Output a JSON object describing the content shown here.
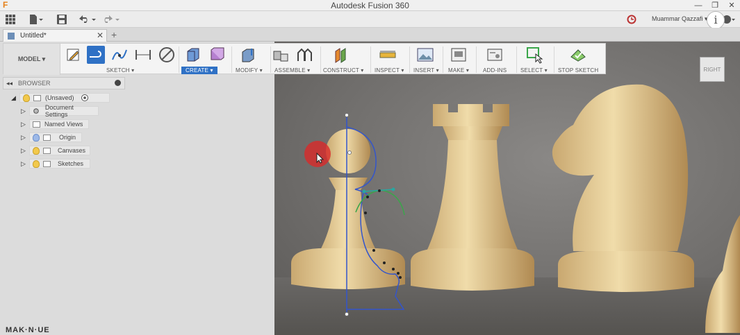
{
  "window": {
    "title": "Autodesk Fusion 360",
    "logo": "F"
  },
  "quick_access": {
    "user_name": "Muammar Qazzafi ▾"
  },
  "info_badge": "i",
  "tabs": {
    "document": "Untitled*",
    "close": "✕",
    "new": "+"
  },
  "toolbar": {
    "workspace": "MODEL ▾",
    "groups": [
      {
        "label": "SKETCH ▾"
      },
      {
        "label": "CREATE ▾"
      },
      {
        "label": "MODIFY ▾"
      },
      {
        "label": "ASSEMBLE ▾"
      },
      {
        "label": "CONSTRUCT ▾"
      },
      {
        "label": "INSPECT ▾"
      },
      {
        "label": "INSERT ▾"
      },
      {
        "label": "MAKE ▾"
      },
      {
        "label": "ADD-INS"
      },
      {
        "label": "SELECT ▾"
      },
      {
        "label": "STOP SKETCH"
      }
    ]
  },
  "browser": {
    "title": "BROWSER",
    "root": "(Unsaved)",
    "items": [
      {
        "label": "Document Settings"
      },
      {
        "label": "Named Views"
      },
      {
        "label": "Origin"
      },
      {
        "label": "Canvases"
      },
      {
        "label": "Sketches"
      }
    ]
  },
  "viewcube": {
    "face": "RIGHT"
  },
  "watermark": "MAK·N·UE",
  "colors": {
    "accent": "#2f71c5",
    "sketch_line": "#3355cc",
    "constraint": "#2aa6a0"
  }
}
